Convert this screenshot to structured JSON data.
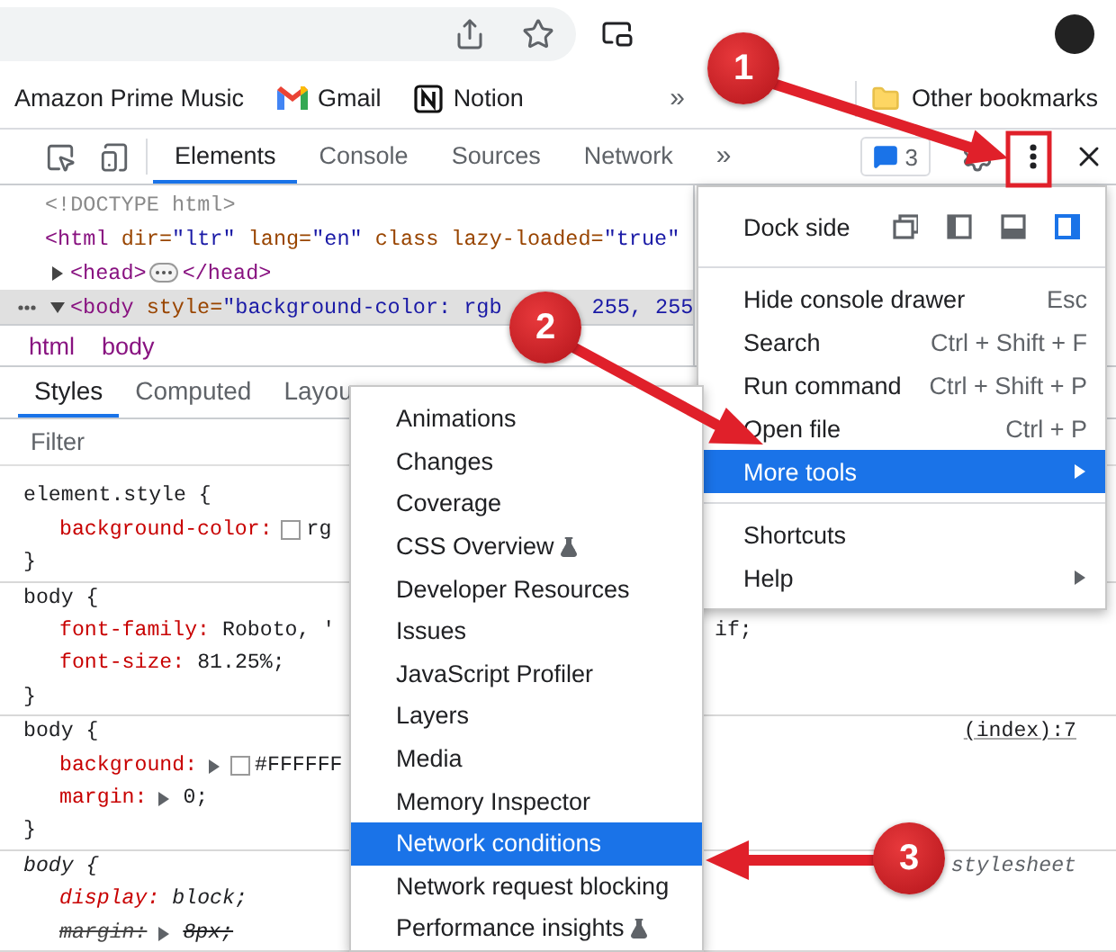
{
  "bookmarks_bar": {
    "items": [
      {
        "label": "Amazon Prime Music",
        "kind": "plain"
      },
      {
        "label": "Gmail",
        "kind": "gmail"
      },
      {
        "label": "Notion",
        "kind": "notion"
      }
    ],
    "overflow": "»",
    "other": {
      "label": "Other bookmarks"
    }
  },
  "devtools_toolbar": {
    "tabs": [
      {
        "label": "Elements",
        "selected": true
      },
      {
        "label": "Console",
        "selected": false
      },
      {
        "label": "Sources",
        "selected": false
      },
      {
        "label": "Network",
        "selected": false
      }
    ],
    "more": "»",
    "issues": "3"
  },
  "elements": {
    "lines": [
      {
        "kind": "text",
        "selected": false,
        "tokens": [
          {
            "kind": "doctype",
            "text": "<!DOCTYPE html>"
          }
        ]
      },
      {
        "kind": "text",
        "selected": false,
        "tokens": [
          {
            "kind": "tag",
            "text": "<html"
          },
          {
            "kind": "attr",
            "text": " dir="
          },
          {
            "kind": "value",
            "text": "\"ltr\""
          },
          {
            "kind": "attr",
            "text": " lang="
          },
          {
            "kind": "value",
            "text": "\"en\""
          },
          {
            "kind": "attr",
            "text": " class lazy-loaded="
          },
          {
            "kind": "value",
            "text": "\"true\""
          }
        ]
      },
      {
        "kind": "node",
        "expanded": false,
        "selected": false,
        "tokens": [
          {
            "kind": "tag",
            "text": "<head>"
          },
          {
            "kind": "ellipsis"
          },
          {
            "kind": "tag",
            "text": "</head>"
          }
        ]
      },
      {
        "kind": "node",
        "expanded": true,
        "selected": true,
        "tokens": [
          {
            "kind": "tag",
            "text": "<body"
          },
          {
            "kind": "attr",
            "text": " style="
          },
          {
            "kind": "value",
            "text": "\"background-color: rgb"
          },
          {
            "kind": "covered"
          },
          {
            "kind": "value",
            "text": "255, 255"
          }
        ]
      }
    ]
  },
  "breadcrumbs": [
    {
      "label": "html"
    },
    {
      "label": "body"
    }
  ],
  "styles_tabs": [
    {
      "label": "Styles",
      "selected": true
    },
    {
      "label": "Computed",
      "selected": false
    },
    {
      "label": "Layou",
      "selected": false
    }
  ],
  "filter": {
    "placeholder": "Filter"
  },
  "rules": [
    {
      "selector": "element.style {",
      "user_agent": false,
      "close": "}",
      "declarations": [
        {
          "property": "background-color:",
          "value": "rg",
          "swatch": true,
          "expander": false,
          "struck": false
        }
      ]
    },
    {
      "selector": "body {",
      "user_agent": false,
      "close": "}",
      "declarations": [
        {
          "property": "font-family:",
          "value": "Roboto, '",
          "tail": "if;",
          "swatch": false,
          "expander": false,
          "struck": false
        },
        {
          "property": "font-size:",
          "value": "81.25%;",
          "swatch": false,
          "expander": false,
          "struck": false
        }
      ]
    },
    {
      "selector": "body {",
      "user_agent": false,
      "source": "(index):7",
      "close": "}",
      "declarations": [
        {
          "property": "background:",
          "value": "#FFFFFF",
          "swatch": true,
          "expander": true,
          "struck": false
        },
        {
          "property": "margin:",
          "value": "0;",
          "swatch": false,
          "expander": true,
          "struck": false
        }
      ]
    },
    {
      "selector": "body {",
      "user_agent": true,
      "source": "stylesheet",
      "declarations": [
        {
          "property": "display:",
          "value": "block;",
          "swatch": false,
          "expander": false,
          "struck": false
        },
        {
          "property": "margin:",
          "value": "8px;",
          "swatch": false,
          "expander": true,
          "struck": true
        }
      ]
    }
  ],
  "main_menu": {
    "dock_side": {
      "label": "Dock side",
      "options": [
        {
          "kind": "undock",
          "selected": false
        },
        {
          "kind": "left",
          "selected": false
        },
        {
          "kind": "bottom",
          "selected": false
        },
        {
          "kind": "right",
          "selected": true
        }
      ]
    },
    "groups": [
      [
        {
          "label": "Hide console drawer",
          "shortcut": "Esc",
          "submenu": false,
          "selected": false
        },
        {
          "label": "Search",
          "shortcut": "Ctrl + Shift + F",
          "submenu": false,
          "selected": false
        },
        {
          "label": "Run command",
          "shortcut": "Ctrl + Shift + P",
          "submenu": false,
          "selected": false
        },
        {
          "label": "Open file",
          "shortcut": "Ctrl + P",
          "submenu": false,
          "selected": false
        },
        {
          "label": "More tools",
          "submenu": true,
          "selected": true
        }
      ],
      [
        {
          "label": "Shortcuts",
          "submenu": false,
          "selected": false
        },
        {
          "label": "Help",
          "submenu": true,
          "selected": false
        }
      ]
    ]
  },
  "more_tools_menu": {
    "items": [
      {
        "label": "Animations",
        "experimental": false,
        "selected": false
      },
      {
        "label": "Changes",
        "experimental": false,
        "selected": false
      },
      {
        "label": "Coverage",
        "experimental": false,
        "selected": false
      },
      {
        "label": "CSS Overview",
        "experimental": true,
        "selected": false
      },
      {
        "label": "Developer Resources",
        "experimental": false,
        "selected": false
      },
      {
        "label": "Issues",
        "experimental": false,
        "selected": false
      },
      {
        "label": "JavaScript Profiler",
        "experimental": false,
        "selected": false
      },
      {
        "label": "Layers",
        "experimental": false,
        "selected": false
      },
      {
        "label": "Media",
        "experimental": false,
        "selected": false
      },
      {
        "label": "Memory Inspector",
        "experimental": false,
        "selected": false
      },
      {
        "label": "Network conditions",
        "experimental": false,
        "selected": true
      },
      {
        "label": "Network request blocking",
        "experimental": false,
        "selected": false
      },
      {
        "label": "Performance insights",
        "experimental": true,
        "selected": false
      }
    ]
  },
  "callouts": [
    {
      "number": "1"
    },
    {
      "number": "2"
    },
    {
      "number": "3"
    }
  ]
}
